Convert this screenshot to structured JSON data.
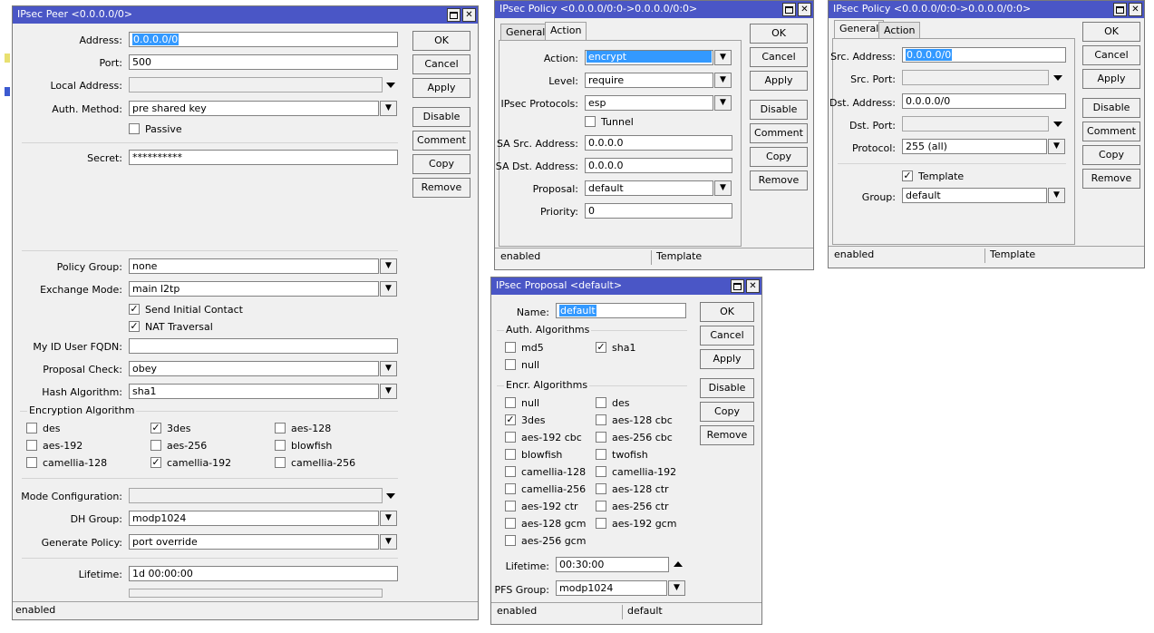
{
  "peer": {
    "title": "IPsec Peer <0.0.0.0/0>",
    "fields": {
      "address": {
        "label": "Address:",
        "value": "0.0.0.0/0"
      },
      "port": {
        "label": "Port:",
        "value": "500"
      },
      "local_address": {
        "label": "Local Address:",
        "value": ""
      },
      "auth_method": {
        "label": "Auth. Method:",
        "value": "pre shared key"
      },
      "passive": {
        "label": "Passive"
      },
      "secret": {
        "label": "Secret:",
        "value": "**********"
      },
      "policy_group": {
        "label": "Policy Group:",
        "value": "none"
      },
      "exchange_mode": {
        "label": "Exchange Mode:",
        "value": "main l2tp"
      },
      "send_initial_contact": {
        "label": "Send Initial Contact"
      },
      "nat_traversal": {
        "label": "NAT Traversal"
      },
      "my_id": {
        "label": "My ID User FQDN:",
        "value": ""
      },
      "proposal_check": {
        "label": "Proposal Check:",
        "value": "obey"
      },
      "hash_algorithm": {
        "label": "Hash Algorithm:",
        "value": "sha1"
      },
      "mode_config": {
        "label": "Mode Configuration:",
        "value": ""
      },
      "dh_group": {
        "label": "DH Group:",
        "value": "modp1024"
      },
      "generate_policy": {
        "label": "Generate Policy:",
        "value": "port override"
      },
      "lifetime": {
        "label": "Lifetime:",
        "value": "1d 00:00:00"
      }
    },
    "enc_group": "Encryption Algorithm",
    "enc": [
      {
        "label": "des",
        "checked": false
      },
      {
        "label": "3des",
        "checked": true
      },
      {
        "label": "aes-128",
        "checked": false
      },
      {
        "label": "aes-192",
        "checked": false
      },
      {
        "label": "aes-256",
        "checked": false
      },
      {
        "label": "blowfish",
        "checked": false
      },
      {
        "label": "camellia-128",
        "checked": false
      },
      {
        "label": "camellia-192",
        "checked": true
      },
      {
        "label": "camellia-256",
        "checked": false
      }
    ],
    "buttons": [
      "OK",
      "Cancel",
      "Apply",
      "Disable",
      "Comment",
      "Copy",
      "Remove"
    ],
    "status": "enabled"
  },
  "policy1": {
    "title": "IPsec Policy <0.0.0.0/0:0->0.0.0.0/0:0>",
    "tabs": [
      "General",
      "Action"
    ],
    "action": {
      "label": "Action:",
      "value": "encrypt"
    },
    "level": {
      "label": "Level:",
      "value": "require"
    },
    "protocols": {
      "label": "IPsec Protocols:",
      "value": "esp"
    },
    "tunnel": {
      "label": "Tunnel"
    },
    "sa_src": {
      "label": "SA Src. Address:",
      "value": "0.0.0.0"
    },
    "sa_dst": {
      "label": "SA Dst. Address:",
      "value": "0.0.0.0"
    },
    "proposal": {
      "label": "Proposal:",
      "value": "default"
    },
    "priority": {
      "label": "Priority:",
      "value": "0"
    },
    "buttons": [
      "OK",
      "Cancel",
      "Apply",
      "Disable",
      "Comment",
      "Copy",
      "Remove"
    ],
    "status": [
      "enabled",
      "Template"
    ]
  },
  "policy2": {
    "title": "IPsec Policy <0.0.0.0/0:0->0.0.0.0/0:0>",
    "tabs": [
      "General",
      "Action"
    ],
    "src_address": {
      "label": "Src. Address:",
      "value": "0.0.0.0/0"
    },
    "src_port": {
      "label": "Src. Port:",
      "value": ""
    },
    "dst_address": {
      "label": "Dst. Address:",
      "value": "0.0.0.0/0"
    },
    "dst_port": {
      "label": "Dst. Port:",
      "value": ""
    },
    "protocol": {
      "label": "Protocol:",
      "value": "255 (all)"
    },
    "template": {
      "label": "Template"
    },
    "group": {
      "label": "Group:",
      "value": "default"
    },
    "buttons": [
      "OK",
      "Cancel",
      "Apply",
      "Disable",
      "Comment",
      "Copy",
      "Remove"
    ],
    "status": [
      "enabled",
      "Template"
    ]
  },
  "proposal": {
    "title": "IPsec Proposal <default>",
    "name": {
      "label": "Name:",
      "value": "default"
    },
    "auth_group": "Auth. Algorithms",
    "auth": [
      {
        "label": "md5",
        "checked": false
      },
      {
        "label": "sha1",
        "checked": true
      },
      {
        "label": "null",
        "checked": false
      }
    ],
    "encr_group": "Encr. Algorithms",
    "encr": [
      {
        "label": "null",
        "checked": false
      },
      {
        "label": "des",
        "checked": false
      },
      {
        "label": "3des",
        "checked": true
      },
      {
        "label": "aes-128 cbc",
        "checked": false
      },
      {
        "label": "aes-192 cbc",
        "checked": false
      },
      {
        "label": "aes-256 cbc",
        "checked": false
      },
      {
        "label": "blowfish",
        "checked": false
      },
      {
        "label": "twofish",
        "checked": false
      },
      {
        "label": "camellia-128",
        "checked": false
      },
      {
        "label": "camellia-192",
        "checked": false
      },
      {
        "label": "camellia-256",
        "checked": false
      },
      {
        "label": "aes-128 ctr",
        "checked": false
      },
      {
        "label": "aes-192 ctr",
        "checked": false
      },
      {
        "label": "aes-256 ctr",
        "checked": false
      },
      {
        "label": "aes-128 gcm",
        "checked": false
      },
      {
        "label": "aes-192 gcm",
        "checked": false
      },
      {
        "label": "aes-256 gcm",
        "checked": false
      }
    ],
    "lifetime": {
      "label": "Lifetime:",
      "value": "00:30:00"
    },
    "pfs": {
      "label": "PFS Group:",
      "value": "modp1024"
    },
    "buttons": [
      "OK",
      "Cancel",
      "Apply",
      "Disable",
      "Copy",
      "Remove"
    ],
    "status": [
      "enabled",
      "default"
    ]
  }
}
